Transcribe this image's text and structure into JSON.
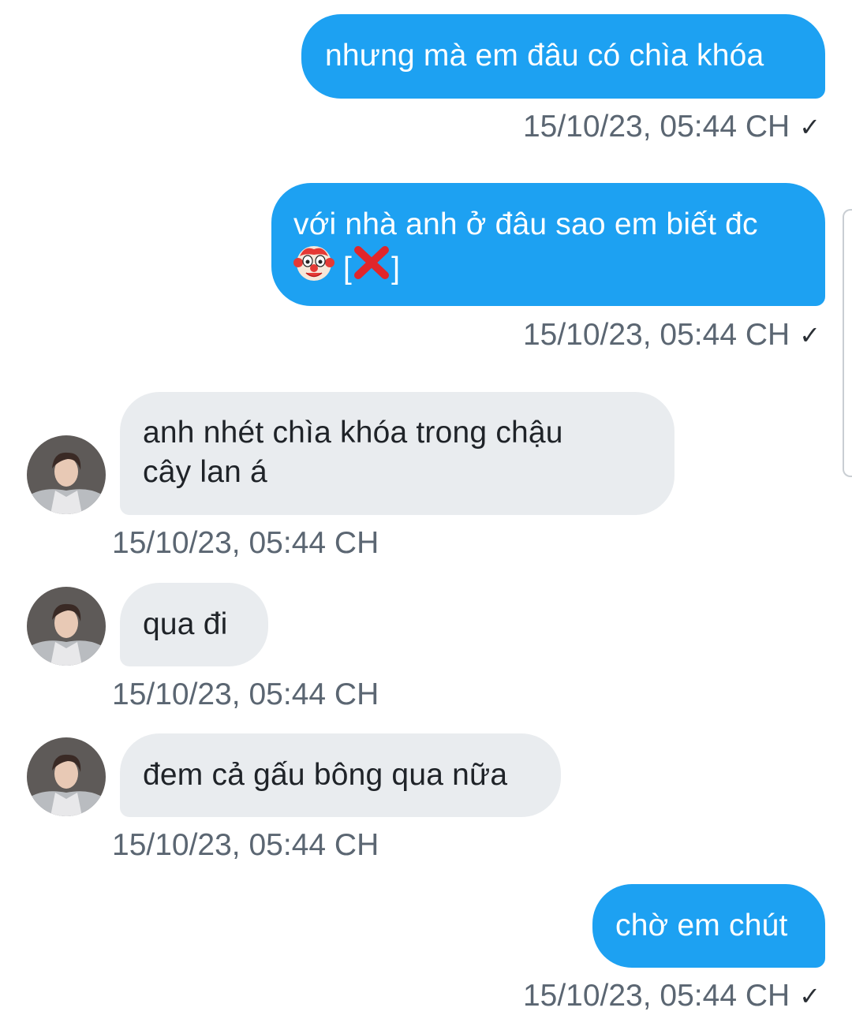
{
  "messages": [
    {
      "direction": "outgoing",
      "text": "nhưng mà em đâu có chìa khóa",
      "timestamp": "15/10/23, 05:44 CH",
      "status_icon": "check-icon"
    },
    {
      "direction": "outgoing",
      "text_line1": "với nhà anh ở đâu sao em biết đc",
      "emoji_1": "clown-face-emoji",
      "bracket_open": "[",
      "emoji_2": "cross-mark-emoji",
      "bracket_close": "]",
      "timestamp": "15/10/23, 05:44 CH",
      "status_icon": "check-icon"
    },
    {
      "direction": "incoming",
      "text_line1": "anh nhét chìa khóa trong chậu",
      "text_line2": "cây lan á",
      "timestamp": "15/10/23, 05:44 CH"
    },
    {
      "direction": "incoming",
      "text": "qua đi",
      "timestamp": "15/10/23, 05:44 CH"
    },
    {
      "direction": "incoming",
      "text": "đem cả gấu bông qua nữa",
      "timestamp": "15/10/23, 05:44 CH"
    },
    {
      "direction": "outgoing",
      "text": "chờ em chút",
      "timestamp": "15/10/23, 05:44 CH",
      "status_icon": "check-icon"
    }
  ],
  "check_glyph": "✓",
  "colors": {
    "outgoing_bubble": "#1da1f2",
    "incoming_bubble": "#e9ecef",
    "timestamp": "#5b6672"
  }
}
